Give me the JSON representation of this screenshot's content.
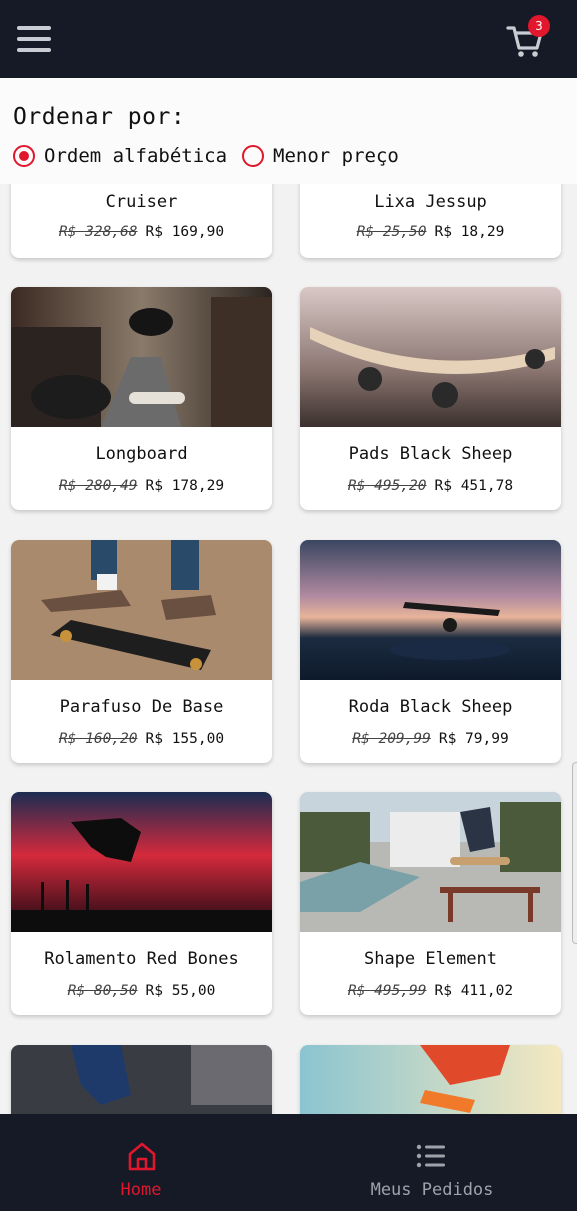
{
  "header": {
    "menu_icon": "hamburger-menu-icon",
    "cart_icon": "shopping-cart-icon",
    "cart_count": "3",
    "accent_color": "#e0172d",
    "bar_color": "#161a26"
  },
  "sort": {
    "title": "Ordenar por:",
    "options": [
      {
        "label": "Ordem alfabética",
        "selected": true
      },
      {
        "label": "Menor preço",
        "selected": false
      }
    ]
  },
  "products": [
    {
      "name": "Cruiser",
      "old_price": "R$ 328,68",
      "price": "R$ 169,90"
    },
    {
      "name": "Lixa Jessup",
      "old_price": "R$ 25,50",
      "price": "R$ 18,29"
    },
    {
      "name": "Longboard",
      "old_price": "R$ 280,49",
      "price": "R$ 178,29"
    },
    {
      "name": "Pads Black Sheep",
      "old_price": "R$ 495,20",
      "price": "R$ 451,78"
    },
    {
      "name": "Parafuso De Base",
      "old_price": "R$ 160,20",
      "price": "R$ 155,00"
    },
    {
      "name": "Roda Black Sheep",
      "old_price": "R$ 209,99",
      "price": "R$ 79,99"
    },
    {
      "name": "Rolamento Red Bones",
      "old_price": "R$ 80,50",
      "price": "R$ 55,00"
    },
    {
      "name": "Shape Element",
      "old_price": "R$ 495,99",
      "price": "R$ 411,02"
    }
  ],
  "bottom_nav": [
    {
      "label": "Home",
      "icon": "home-icon",
      "active": true
    },
    {
      "label": "Meus Pedidos",
      "icon": "list-icon",
      "active": false
    }
  ]
}
